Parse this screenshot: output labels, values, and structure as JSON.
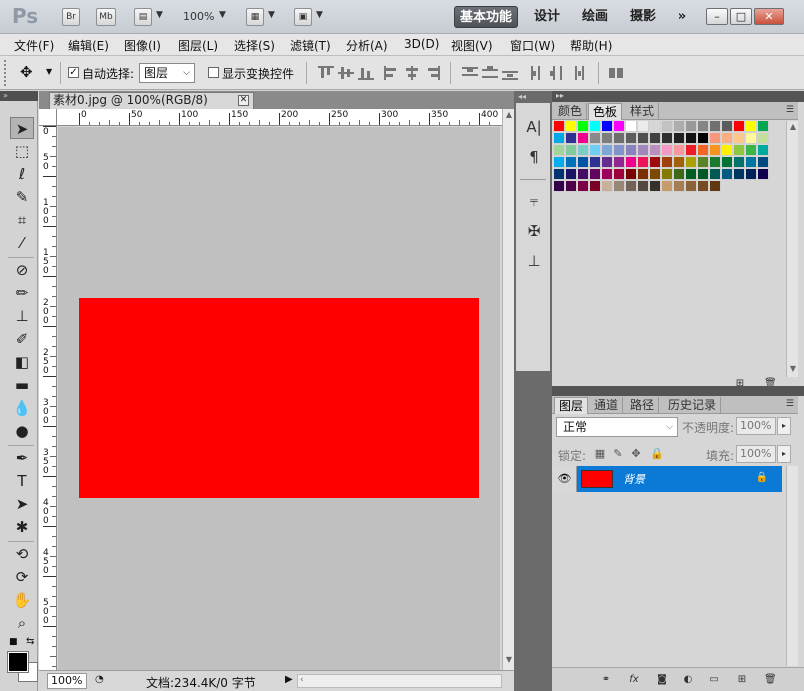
{
  "titlebar": {
    "logo": "Ps",
    "br": "Br",
    "mb": "Mb",
    "zoom": "100%",
    "workspaces": [
      "基本功能",
      "设计",
      "绘画",
      "摄影"
    ],
    "more": "»"
  },
  "menu": [
    "文件(F)",
    "编辑(E)",
    "图像(I)",
    "图层(L)",
    "选择(S)",
    "滤镜(T)",
    "分析(A)",
    "3D(D)",
    "视图(V)",
    "窗口(W)",
    "帮助(H)"
  ],
  "options": {
    "auto_select_label": "自动选择:",
    "auto_select_value": "图层",
    "show_transform_label": "显示变换控件",
    "auto_select_checked": true,
    "show_transform_checked": false
  },
  "document": {
    "tab_title": "素材0.jpg @ 100%(RGB/8)",
    "ruler_h": [
      "0",
      "50",
      "100",
      "150",
      "200",
      "250",
      "300",
      "350",
      "400"
    ],
    "ruler_v": [
      "0",
      "5\n0",
      "1\n0\n0",
      "1\n5\n0",
      "2\n0\n0",
      "2\n5\n0",
      "3\n0\n0",
      "3\n5\n0",
      "4\n0\n0",
      "4\n5\n0",
      "5\n0\n0"
    ],
    "canvas_bg": "#c0c0c0",
    "shape_color": "#fd0000"
  },
  "status": {
    "zoom": "100%",
    "doc_info": "文档:234.4K/0 字节"
  },
  "swatch_panel": {
    "tabs": [
      "颜色",
      "色板",
      "样式"
    ],
    "active_tab": "色板"
  },
  "layers_panel": {
    "tabs": [
      "图层",
      "通道",
      "路径",
      "历史记录"
    ],
    "active_tab": "图层",
    "blend_mode": "正常",
    "opacity_label": "不透明度:",
    "opacity_value": "100%",
    "lock_label": "锁定:",
    "fill_label": "填充:",
    "fill_value": "100%",
    "layers": [
      {
        "name": "背景",
        "color": "#fd0000",
        "visible": true,
        "locked": true
      }
    ]
  },
  "colors": {
    "accent": "#0a7ad6",
    "fg_color": "#000000",
    "bg_color": "#ffffff"
  }
}
